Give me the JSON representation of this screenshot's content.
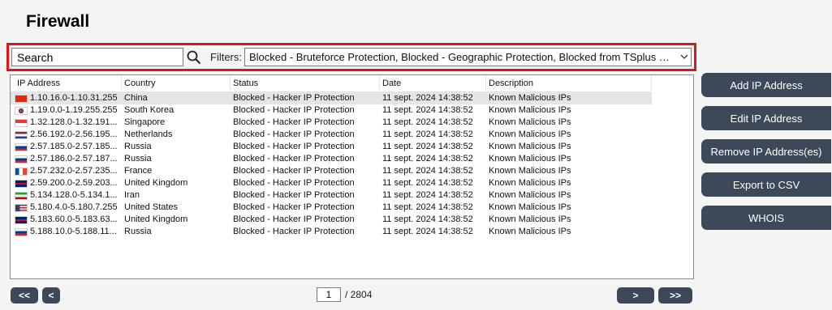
{
  "title": "Firewall",
  "search": {
    "value": "Search",
    "icon": "search-icon"
  },
  "filters": {
    "label": "Filters:",
    "selected": "Blocked - Bruteforce Protection, Blocked - Geographic Protection, Blocked from TSplus …"
  },
  "columns": [
    "IP Address",
    "Country",
    "Status",
    "Date",
    "Description"
  ],
  "rows": [
    {
      "ip": "1.10.16.0-1.10.31.255",
      "country": "China",
      "flag": "china",
      "status": "Blocked - Hacker IP Protection",
      "date": "11 sept. 2024 14:38:52",
      "description": "Known Malicious IPs",
      "selected": true
    },
    {
      "ip": "1.19.0.0-1.19.255.255",
      "country": "South Korea",
      "flag": "south-korea",
      "status": "Blocked - Hacker IP Protection",
      "date": "11 sept. 2024 14:38:52",
      "description": "Known Malicious IPs"
    },
    {
      "ip": "1.32.128.0-1.32.191...",
      "country": "Singapore",
      "flag": "singapore",
      "status": "Blocked - Hacker IP Protection",
      "date": "11 sept. 2024 14:38:52",
      "description": "Known Malicious IPs"
    },
    {
      "ip": "2.56.192.0-2.56.195...",
      "country": "Netherlands",
      "flag": "netherlands",
      "status": "Blocked - Hacker IP Protection",
      "date": "11 sept. 2024 14:38:52",
      "description": "Known Malicious IPs"
    },
    {
      "ip": "2.57.185.0-2.57.185...",
      "country": "Russia",
      "flag": "russia",
      "status": "Blocked - Hacker IP Protection",
      "date": "11 sept. 2024 14:38:52",
      "description": "Known Malicious IPs"
    },
    {
      "ip": "2.57.186.0-2.57.187...",
      "country": "Russia",
      "flag": "russia",
      "status": "Blocked - Hacker IP Protection",
      "date": "11 sept. 2024 14:38:52",
      "description": "Known Malicious IPs"
    },
    {
      "ip": "2.57.232.0-2.57.235...",
      "country": "France",
      "flag": "france",
      "status": "Blocked - Hacker IP Protection",
      "date": "11 sept. 2024 14:38:52",
      "description": "Known Malicious IPs"
    },
    {
      "ip": "2.59.200.0-2.59.203...",
      "country": "United Kingdom",
      "flag": "united-kingdom",
      "status": "Blocked - Hacker IP Protection",
      "date": "11 sept. 2024 14:38:52",
      "description": "Known Malicious IPs"
    },
    {
      "ip": "5.134.128.0-5.134.1...",
      "country": "Iran",
      "flag": "iran",
      "status": "Blocked - Hacker IP Protection",
      "date": "11 sept. 2024 14:38:52",
      "description": "Known Malicious IPs"
    },
    {
      "ip": "5.180.4.0-5.180.7.255",
      "country": "United States",
      "flag": "united-states",
      "status": "Blocked - Hacker IP Protection",
      "date": "11 sept. 2024 14:38:52",
      "description": "Known Malicious IPs"
    },
    {
      "ip": "5.183.60.0-5.183.63...",
      "country": "United Kingdom",
      "flag": "united-kingdom",
      "status": "Blocked - Hacker IP Protection",
      "date": "11 sept. 2024 14:38:52",
      "description": "Known Malicious IPs"
    },
    {
      "ip": "5.188.10.0-5.188.11...",
      "country": "Russia",
      "flag": "russia",
      "status": "Blocked - Hacker IP Protection",
      "date": "11 sept. 2024 14:38:52",
      "description": "Known Malicious IPs"
    }
  ],
  "actions": [
    {
      "id": "add",
      "label": "Add IP Address"
    },
    {
      "id": "edit",
      "label": "Edit IP Address"
    },
    {
      "id": "remove",
      "label": "Remove IP Address(es)"
    },
    {
      "id": "export",
      "label": "Export to CSV"
    },
    {
      "id": "whois",
      "label": "WHOIS"
    }
  ],
  "pagination": {
    "first": "<<",
    "prev": "<",
    "next": ">",
    "last": ">>",
    "current": "1",
    "total": "/ 2804"
  },
  "colors": {
    "button": "#3d4958",
    "highlight": "#e0151c",
    "selected_row": "#e5e5e5"
  }
}
